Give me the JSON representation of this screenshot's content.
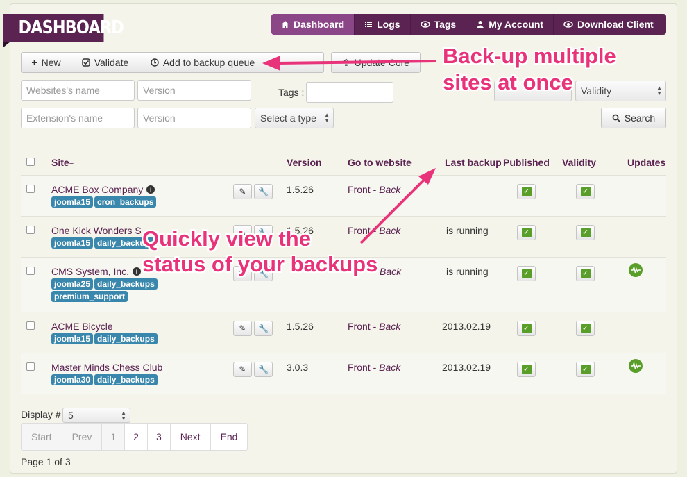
{
  "brand": {
    "title": "DASHBOARD"
  },
  "topnav": [
    {
      "label": "Dashboard",
      "icon": "home-icon",
      "active": true
    },
    {
      "label": "Logs",
      "icon": "list-icon"
    },
    {
      "label": "Tags",
      "icon": "eye-icon"
    },
    {
      "label": "My Account",
      "icon": "user-icon"
    },
    {
      "label": "Download Client",
      "icon": "eye-icon"
    }
  ],
  "toolbar": {
    "new_label": "New",
    "validate_label": "Validate",
    "backup_queue_label": "Add to backup queue",
    "update_core_label": "Update Core"
  },
  "filters": {
    "site_name_placeholder": "Websites's name",
    "version_placeholder": "Version",
    "tags_label": "Tags :",
    "validity_select": "Validity",
    "extension_name_placeholder": "Extension's name",
    "ext_version_placeholder": "Version",
    "type_select": "Select a type",
    "search_label": "Search"
  },
  "table": {
    "headers": {
      "site": "Site",
      "version": "Version",
      "go_to_website": "Go to website",
      "last_backup": "Last backup",
      "published": "Published",
      "validity": "Validity",
      "updates": "Updates"
    },
    "rows": [
      {
        "name": "ACME Box Company",
        "info": true,
        "tags": [
          "joomla15",
          "cron_backups"
        ],
        "version": "1.5.26",
        "front": "Front",
        "back": "Back",
        "last_backup": "",
        "updates": false
      },
      {
        "name": "One Kick Wonders S",
        "info": false,
        "tags": [
          "joomla15",
          "daily_backups"
        ],
        "version": "1.5.26",
        "front": "Front",
        "back": "Back",
        "last_backup": "is running",
        "updates": false
      },
      {
        "name": "CMS System, Inc.",
        "info": true,
        "tags": [
          "joomla25",
          "daily_backups",
          "premium_support"
        ],
        "version": "",
        "front": "",
        "back": "Back",
        "last_backup": "is running",
        "updates": true
      },
      {
        "name": "ACME Bicycle",
        "info": false,
        "tags": [
          "joomla15",
          "daily_backups"
        ],
        "version": "1.5.26",
        "front": "Front",
        "back": "Back",
        "last_backup": "2013.02.19",
        "updates": false
      },
      {
        "name": "Master Minds Chess Club",
        "info": false,
        "tags": [
          "joomla30",
          "daily_backups"
        ],
        "version": "3.0.3",
        "front": "Front",
        "back": "Back",
        "last_backup": "2013.02.19",
        "updates": true
      }
    ]
  },
  "display": {
    "label": "Display #",
    "value": "5"
  },
  "pagination": {
    "items": [
      "Start",
      "Prev",
      "1",
      "2",
      "3",
      "Next",
      "End"
    ],
    "page_info": "Page 1 of 3"
  },
  "callouts": {
    "backup_line1": "Back-up multiple",
    "backup_line2": "sites at once",
    "status_line1": "Quickly view the",
    "status_line2": "status of your backups"
  },
  "colors": {
    "brand": "#5b2352",
    "accent": "#e8337a",
    "tag": "#3a87ad",
    "check": "#5a9e2a"
  }
}
